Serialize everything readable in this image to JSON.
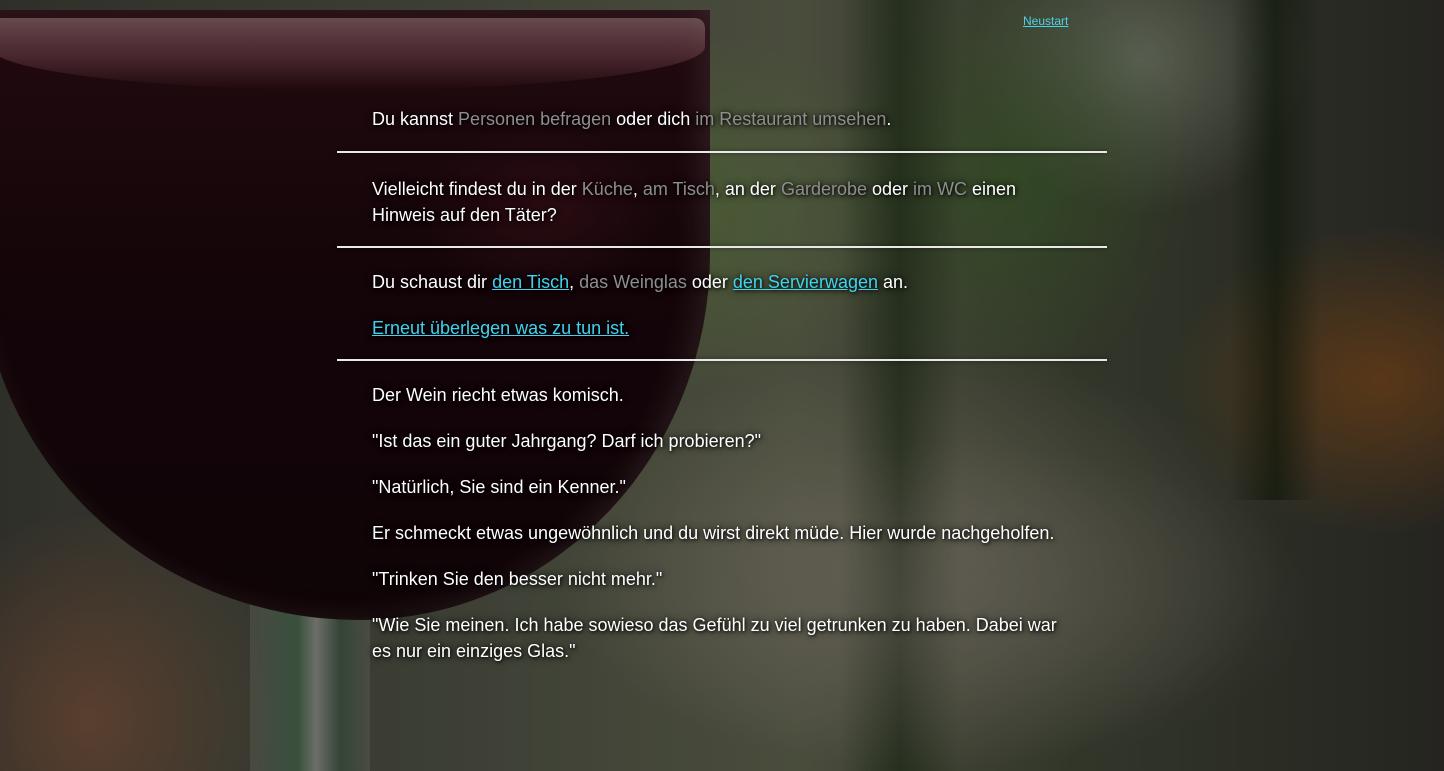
{
  "header": {
    "restart_label": "Neustart"
  },
  "section1": {
    "pre": "Du kannst ",
    "opt_people": "Personen befragen",
    "mid": " oder dich ",
    "opt_look": "im Restaurant umsehen",
    "end": "."
  },
  "section2": {
    "pre": "Vielleicht findest du in der ",
    "opt_kitchen": "Küche",
    "c1": ", ",
    "opt_table": "am Tisch",
    "c2": ", an der ",
    "opt_wardrobe": "Garderobe",
    "c3": " oder ",
    "opt_wc": "im WC",
    "end": " einen Hinweis auf den Täter?"
  },
  "section3": {
    "pre": "Du schaust dir ",
    "link_table": "den Tisch",
    "c1": ", ",
    "opt_glass": "das Weinglas",
    "c2": " oder ",
    "link_trolley": "den Servierwagen",
    "end": " an.",
    "reconsider": "Erneut überlegen was zu tun ist."
  },
  "section4": {
    "lines": [
      "Der Wein riecht etwas komisch.",
      "\"Ist das ein guter Jahrgang? Darf ich probieren?\"",
      "\"Natürlich, Sie sind ein Kenner.\"",
      "Er schmeckt etwas ungewöhnlich und du wirst direkt müde. Hier wurde nachgeholfen.",
      "\"Trinken Sie den besser nicht mehr.\"",
      "\"Wie Sie meinen. Ich habe sowieso das Gefühl zu viel getrunken zu haben. Dabei war es nur ein einziges Glas.\""
    ]
  },
  "colors": {
    "link": "#3fd3ee",
    "muted": "#8e8e8e",
    "text": "#ffffff",
    "separator": "#e8e8e8"
  }
}
